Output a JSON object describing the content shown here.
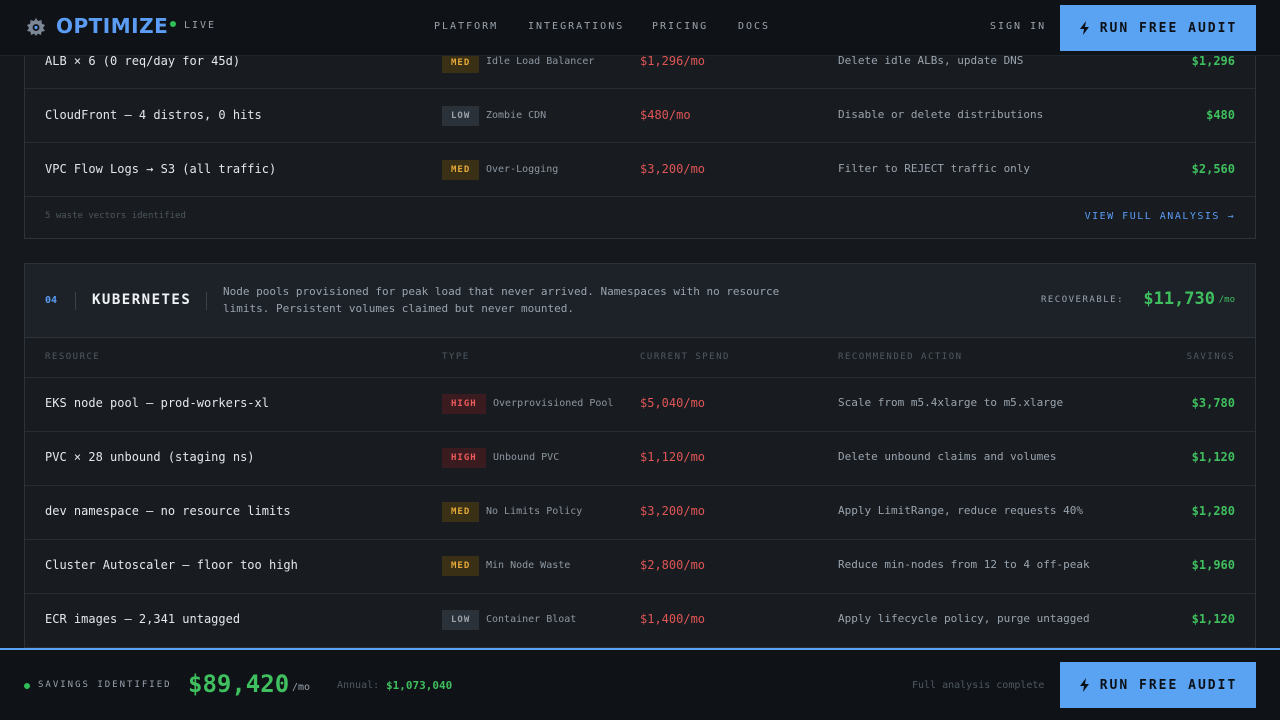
{
  "header": {
    "brand": "OPTIMIZE",
    "status": "LIVE",
    "nav": [
      "PLATFORM",
      "INTEGRATIONS",
      "PRICING",
      "DOCS"
    ],
    "sign_in": "SIGN IN",
    "cta_label": "RUN FREE AUDIT"
  },
  "network_section": {
    "rows": [
      {
        "resource": "ALB × 6 (0 req/day for 45d)",
        "severity": "MED",
        "type": "Idle Load Balancer",
        "spend": "$1,296/mo",
        "action": "Delete idle ALBs, update DNS",
        "savings": "$1,296"
      },
      {
        "resource": "CloudFront — 4 distros, 0 hits",
        "severity": "LOW",
        "type": "Zombie CDN",
        "spend": "$480/mo",
        "action": "Disable or delete distributions",
        "savings": "$480"
      },
      {
        "resource": "VPC Flow Logs → S3 (all traffic)",
        "severity": "MED",
        "type": "Over-Logging",
        "spend": "$3,200/mo",
        "action": "Filter to REJECT traffic only",
        "savings": "$2,560"
      }
    ],
    "footer_note": "5 waste vectors identified",
    "view_link": "VIEW FULL ANALYSIS →"
  },
  "kubernetes_section": {
    "number": "04",
    "title": "KUBERNETES",
    "description": "Node pools provisioned for peak load that never arrived. Namespaces with no resource limits. Persistent volumes claimed but never mounted.",
    "recoverable_label": "RECOVERABLE:",
    "recoverable_value": "$11,730",
    "recoverable_unit": "/mo",
    "columns": [
      "RESOURCE",
      "TYPE",
      "CURRENT SPEND",
      "RECOMMENDED ACTION",
      "SAVINGS"
    ],
    "rows": [
      {
        "resource": "EKS node pool — prod-workers-xl",
        "severity": "HIGH",
        "type": "Overprovisioned Pool",
        "spend": "$5,040/mo",
        "action": "Scale from m5.4xlarge to m5.xlarge",
        "savings": "$3,780"
      },
      {
        "resource": "PVC × 28 unbound (staging ns)",
        "severity": "HIGH",
        "type": "Unbound PVC",
        "spend": "$1,120/mo",
        "action": "Delete unbound claims and volumes",
        "savings": "$1,120"
      },
      {
        "resource": "dev namespace — no resource limits",
        "severity": "MED",
        "type": "No Limits Policy",
        "spend": "$3,200/mo",
        "action": "Apply LimitRange, reduce requests 40%",
        "savings": "$1,280"
      },
      {
        "resource": "Cluster Autoscaler — floor too high",
        "severity": "MED",
        "type": "Min Node Waste",
        "spend": "$2,800/mo",
        "action": "Reduce min-nodes from 12 to 4 off-peak",
        "savings": "$1,960"
      },
      {
        "resource": "ECR images — 2,341 untagged",
        "severity": "LOW",
        "type": "Container Bloat",
        "spend": "$1,400/mo",
        "action": "Apply lifecycle policy, purge untagged",
        "savings": "$1,120"
      }
    ]
  },
  "bottom_bar": {
    "label": "SAVINGS IDENTIFIED",
    "amount": "$89,420",
    "unit": "/mo",
    "annual_label": "Annual:",
    "annual_value": "$1,073,040",
    "status": "Full analysis complete",
    "cta_label": "RUN FREE AUDIT"
  },
  "colors": {
    "accent": "#5aa2f2",
    "savings_green": "#3fbf5e",
    "spend_red": "#e05555",
    "high": "#ef5a5a",
    "med": "#e5a93a",
    "background": "#15191e"
  }
}
